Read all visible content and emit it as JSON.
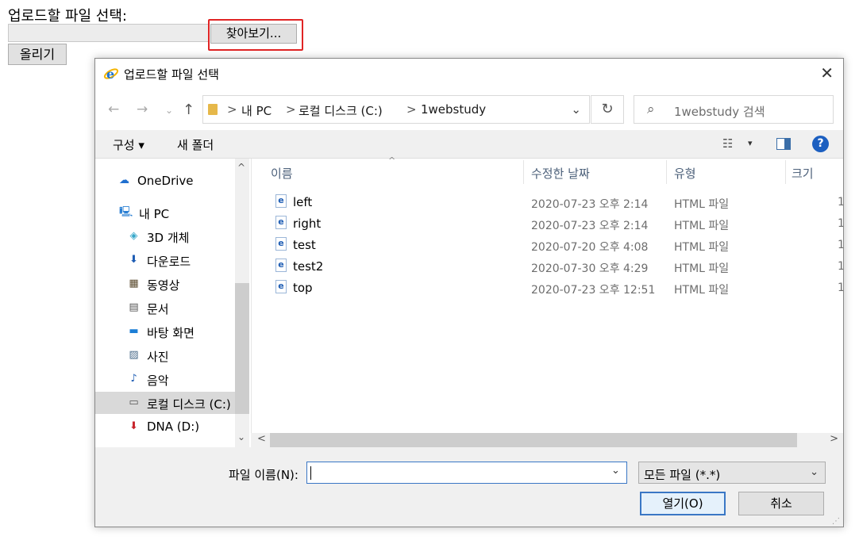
{
  "page": {
    "label": "업로드할 파일 선택:",
    "browse_label": "찾아보기...",
    "upload_label": "올리기"
  },
  "dialog": {
    "title": "업로드할 파일 선택",
    "close": "✕",
    "nav": {
      "back": "←",
      "forward": "→",
      "dropdown": "⌄",
      "up": "↑"
    },
    "breadcrumb": [
      "내 PC",
      "로컬 디스크 (C:)",
      "1webstudy"
    ],
    "breadcrumb_separator": ">",
    "address_dropdown": "⌄",
    "refresh": "↻",
    "search_placeholder": "1webstudy 검색",
    "search_icon": "⌕",
    "toolbar": {
      "organize": "구성 ▾",
      "new_folder": "새 폴더",
      "view_icon": "☷",
      "view_drop": "▾",
      "help": "?"
    },
    "nav_pane": [
      {
        "label": "OneDrive",
        "icon": "☁",
        "color": "#1f6fcf",
        "selected": false
      },
      {
        "label": "내 PC",
        "icon": "🖳",
        "color": "#2a7fd3",
        "selected": false
      },
      {
        "label": "3D 개체",
        "icon": "◈",
        "color": "#36a7c9",
        "selected": false
      },
      {
        "label": "다운로드",
        "icon": "⬇",
        "color": "#1e5db4",
        "selected": false
      },
      {
        "label": "동영상",
        "icon": "▦",
        "color": "#5a4a2e",
        "selected": false
      },
      {
        "label": "문서",
        "icon": "▤",
        "color": "#555555",
        "selected": false
      },
      {
        "label": "바탕 화면",
        "icon": "▬",
        "color": "#1c7ed6",
        "selected": false
      },
      {
        "label": "사진",
        "icon": "▨",
        "color": "#4a6b8a",
        "selected": false
      },
      {
        "label": "음악",
        "icon": "♪",
        "color": "#1e5db4",
        "selected": false
      },
      {
        "label": "로컬 디스크 (C:)",
        "icon": "▭",
        "color": "#555555",
        "selected": true
      },
      {
        "label": "DNA (D:)",
        "icon": "⬇",
        "color": "#c8252c",
        "selected": false
      }
    ],
    "columns": {
      "name": "이름",
      "date": "수정한 날짜",
      "type": "유형",
      "size": "크기"
    },
    "sort_caret": "^",
    "files": [
      {
        "name": "left",
        "date": "2020-07-23 오후 2:14",
        "type": "HTML 파일",
        "size": "1"
      },
      {
        "name": "right",
        "date": "2020-07-23 오후 2:14",
        "type": "HTML 파일",
        "size": "1"
      },
      {
        "name": "test",
        "date": "2020-07-20 오후 4:08",
        "type": "HTML 파일",
        "size": "1"
      },
      {
        "name": "test2",
        "date": "2020-07-30 오후 4:29",
        "type": "HTML 파일",
        "size": "1"
      },
      {
        "name": "top",
        "date": "2020-07-23 오후 12:51",
        "type": "HTML 파일",
        "size": "1"
      }
    ],
    "file_icon": "e",
    "scroll": {
      "up": "^",
      "down": "⌄",
      "left": "<",
      "right": ">"
    },
    "filename_label": "파일 이름(N):",
    "filename_value": "",
    "filename_drop": "⌄",
    "filetype_value": "모든 파일 (*.*)",
    "filetype_drop": "⌄",
    "open_label": "열기(O)",
    "cancel_label": "취소",
    "grip": "⋰"
  }
}
